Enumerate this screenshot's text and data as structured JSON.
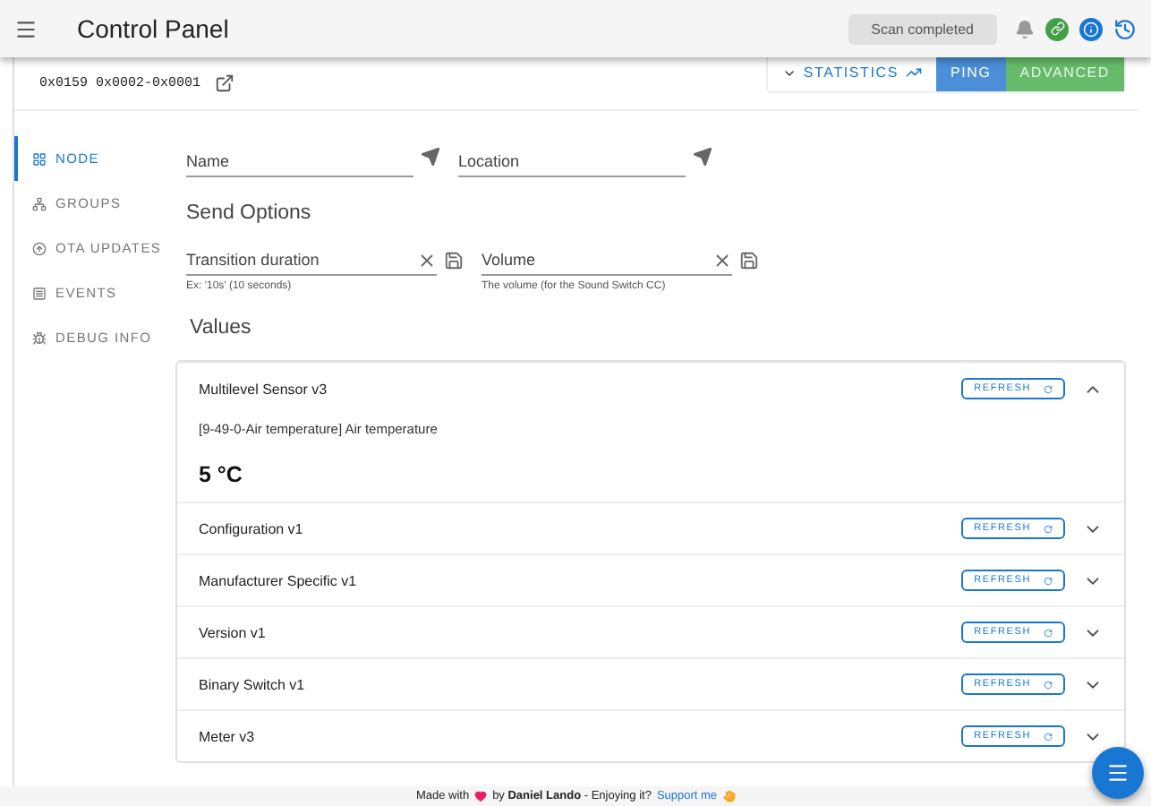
{
  "app_bar": {
    "title": "Control Panel",
    "status": "Scan completed"
  },
  "device": {
    "ids": "0x0159 0x0002-0x0001"
  },
  "actions": {
    "statistics": "STATISTICS",
    "ping": "PING",
    "advanced": "ADVANCED"
  },
  "tabs": [
    {
      "label": "NODE",
      "selected": true
    },
    {
      "label": "GROUPS",
      "selected": false
    },
    {
      "label": "OTA UPDATES",
      "selected": false
    },
    {
      "label": "EVENTS",
      "selected": false
    },
    {
      "label": "DEBUG INFO",
      "selected": false
    }
  ],
  "name_fields": [
    {
      "placeholder": "Name"
    },
    {
      "placeholder": "Location"
    }
  ],
  "send_options": {
    "title": "Send Options",
    "fields": [
      {
        "placeholder": "Transition duration",
        "hint": "Ex: '10s' (10 seconds)"
      },
      {
        "placeholder": "Volume",
        "hint": "The volume (for the Sound Switch CC)"
      }
    ]
  },
  "values": {
    "title": "Values",
    "items": [
      {
        "title": "Multilevel Sensor v3",
        "refresh": "REFRESH",
        "expanded": true,
        "value_label": "[9-49-0-Air temperature] Air temperature",
        "value": "5 °C"
      },
      {
        "title": "Configuration v1",
        "refresh": "REFRESH",
        "expanded": false
      },
      {
        "title": "Manufacturer Specific v1",
        "refresh": "REFRESH",
        "expanded": false
      },
      {
        "title": "Version v1",
        "refresh": "REFRESH",
        "expanded": false
      },
      {
        "title": "Binary Switch v1",
        "refresh": "REFRESH",
        "expanded": false
      },
      {
        "title": "Meter v3",
        "refresh": "REFRESH",
        "expanded": false
      }
    ]
  },
  "footer": {
    "lead": "Made with",
    "middle": "by **Daniel Lando** - Enjoying it?",
    "link": "Support me"
  }
}
